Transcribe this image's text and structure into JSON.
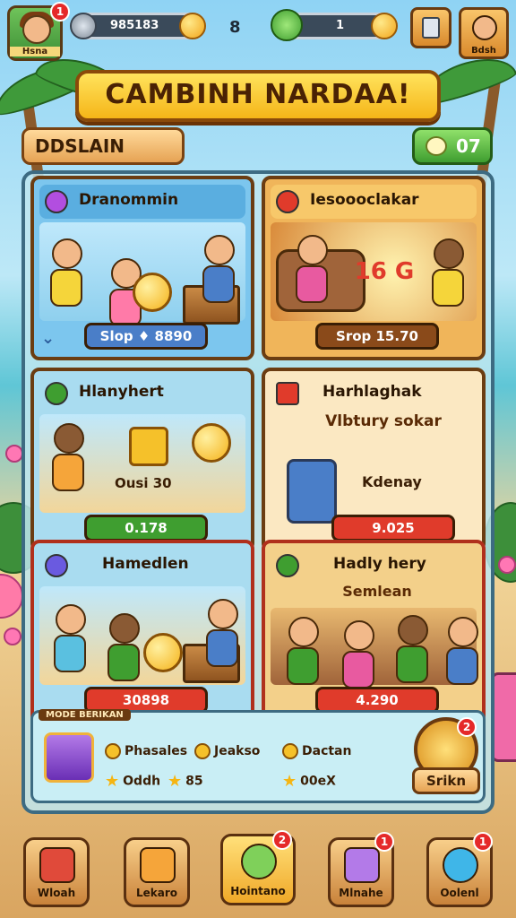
{
  "hud": {
    "player_name": "Hsna",
    "player_badge": "1",
    "coins_value": "985183",
    "middle_count": "8",
    "gems_value": "1",
    "friend_label": "Bdsh"
  },
  "title": "CAMBINH NARDAA!",
  "sub": {
    "left_label": "DDSLAIN",
    "right_value": "07"
  },
  "cards": [
    {
      "title": "Dranommin",
      "price": "Slop ♦ 8890",
      "color": "#7cc6ee",
      "head_color": "#5aaee0",
      "price_color": "#4a7ec8"
    },
    {
      "title": "Iesoooclakar",
      "price": "Srop 15.70",
      "burst_text": "16 G",
      "color": "#f0b55a",
      "head_color": "#f7c86a",
      "price_color": "#8a4a1a"
    },
    {
      "title": "Hlanyhert",
      "price": "0.178",
      "sub_text": "Ousi 30",
      "color": "#a9dcf0",
      "head_color": "#7fd05a",
      "price_color": "#3f9e30"
    },
    {
      "title": "Harhlaghak",
      "subtitle": "Vlbtury sokar",
      "label": "Kdenay",
      "price": "9.025",
      "color": "#fbe8c2",
      "head_color": "#fbe8c2",
      "price_color": "#e03b2b"
    },
    {
      "title": "Hamedlen",
      "price": "30898",
      "color": "#a9dcf0",
      "head_color": "#a9dcf0",
      "price_color": "#e03b2b"
    },
    {
      "title": "Hadly hery",
      "subtitle": "Semlean",
      "price": "4.290",
      "color": "#f3d08a",
      "head_color": "#f3d08a",
      "price_color": "#e03b2b"
    }
  ],
  "rewards": {
    "tag": "MODE BERIKAN",
    "items": [
      {
        "label": "Phasales",
        "icon": "coin"
      },
      {
        "label": "Jeakso",
        "icon": "coin"
      },
      {
        "label": "Oddh",
        "icon": "star"
      },
      {
        "label": "85",
        "icon": "star"
      },
      {
        "label": "Dactan",
        "icon": "coin"
      },
      {
        "label": "00eX",
        "icon": "star"
      }
    ],
    "spin_label": "Srikn",
    "spin_badge": "2"
  },
  "nav": [
    {
      "label": "Wloah",
      "icon": "chest-icon",
      "badge": ""
    },
    {
      "label": "Lekaro",
      "icon": "hammer-icon",
      "badge": ""
    },
    {
      "label": "Hointano",
      "icon": "leaf-icon",
      "badge": "2"
    },
    {
      "label": "Mlnahe",
      "icon": "cube-icon",
      "badge": "1"
    },
    {
      "label": "Oolenl",
      "icon": "bubble-icon",
      "badge": "1"
    }
  ],
  "colors": {
    "wood": "#6b3d12",
    "gold": "#f5b518",
    "green": "#3f9e30",
    "red": "#e03b2b",
    "sky": "#8fd3f4"
  }
}
